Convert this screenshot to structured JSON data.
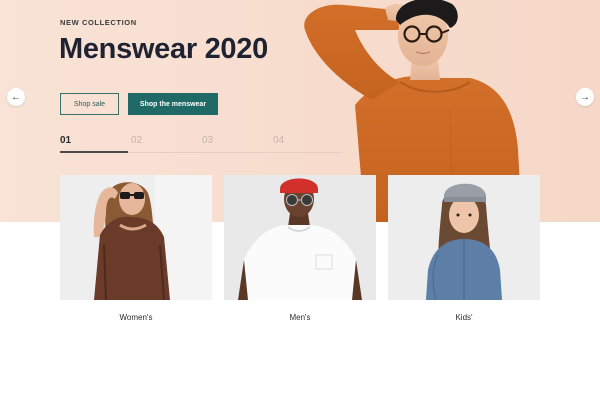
{
  "hero": {
    "eyebrow": "NEW COLLECTION",
    "title": "Menswear 2020",
    "sale_button": "Shop sale",
    "shop_button": "Shop the menswear",
    "steps": [
      "01",
      "02",
      "03",
      "04"
    ],
    "active_step": 1,
    "background_color": "#f8e3d6",
    "accent_color": "#1f6a66"
  },
  "carousel": {
    "prev_icon": "arrow-left-icon",
    "next_icon": "arrow-right-icon"
  },
  "categories": [
    {
      "label": "Women's"
    },
    {
      "label": "Men's"
    },
    {
      "label": "Kids'"
    }
  ]
}
